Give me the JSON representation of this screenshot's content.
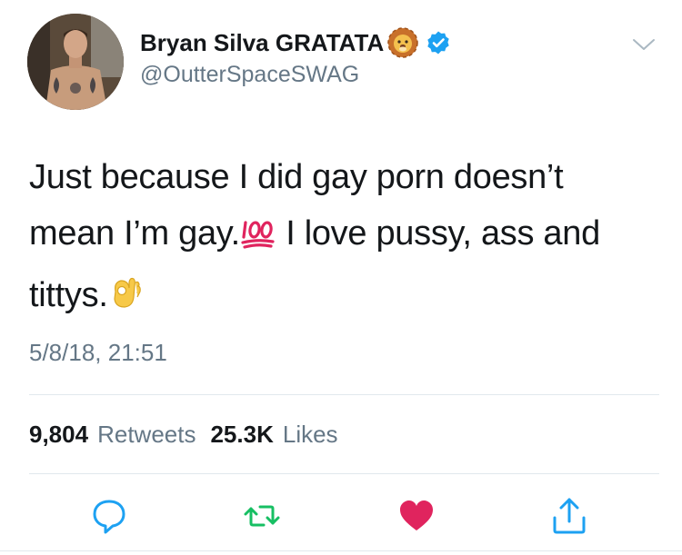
{
  "author": {
    "display_name": "Bryan Silva GRATATA",
    "handle": "@OutterSpaceSWAG",
    "name_emoji": "lion-face-icon",
    "verified": true
  },
  "tweet": {
    "line1": "Just because I did gay porn doesn’t",
    "line2_a": "mean I’m gay.",
    "line2_emoji": "hundred-points-icon",
    "line2_b": " I love pussy, ass and",
    "line3": "tittys.",
    "line3_emoji": "ok-hand-icon",
    "timestamp": "5/8/18, 21:51"
  },
  "stats": {
    "retweets_count": "9,804",
    "retweets_label": "Retweets",
    "likes_count": "25.3K",
    "likes_label": "Likes"
  },
  "colors": {
    "text": "#14171a",
    "secondary": "#657786",
    "verified_blue": "#1da1f2",
    "retweet_green": "#17bf63",
    "like_red": "#e0245e",
    "divider": "#e1e8ed"
  }
}
